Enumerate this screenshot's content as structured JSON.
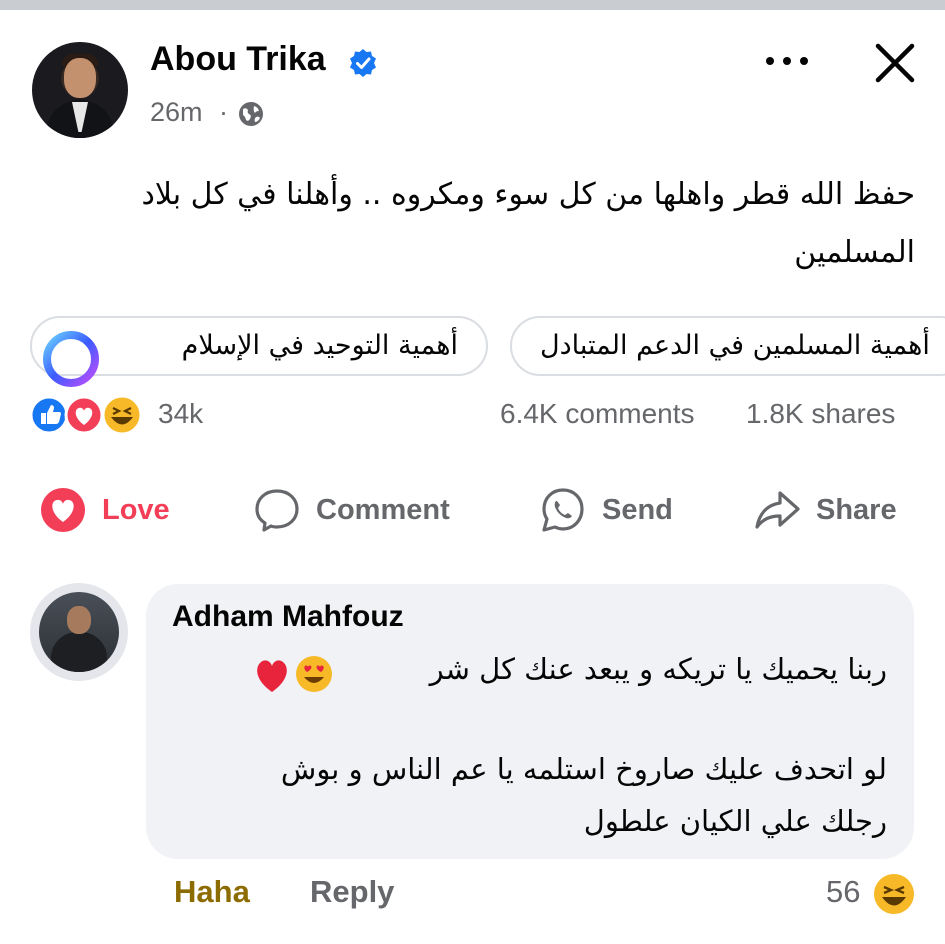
{
  "post": {
    "author": "Abou Trika",
    "time": "26m",
    "separator": "·",
    "text": "حفظ الله قطر واهلها من كل سوء ومكروه .. وأهلنا في كل بلاد المسلمين",
    "verified": true
  },
  "suggestions": [
    {
      "label": "أهمية التوحيد في الإسلام"
    },
    {
      "label": "أهمية المسلمين في الدعم المتبادل"
    }
  ],
  "stats": {
    "reactions": "34k",
    "comments": "6.4K comments",
    "shares": "1.8K shares",
    "reaction_types": [
      "like-icon",
      "love-icon",
      "haha-icon"
    ]
  },
  "actions": {
    "love": "Love",
    "comment": "Comment",
    "send": "Send",
    "share": "Share"
  },
  "comment": {
    "author": "Adham Mahfouz",
    "line1": "ربنا يحميك يا تريكه و يبعد عنك كل شر",
    "line2": "لو اتحدف عليك صاروخ استلمه يا عم الناس و بوش",
    "line3": "رجلك علي الكيان علطول",
    "haha_label": "Haha",
    "reply_label": "Reply",
    "reaction_count": "56"
  },
  "colors": {
    "love": "#f33e58",
    "like": "#1877f2",
    "haha": "#f7b928",
    "secondary_text": "#65676b",
    "bubble": "#f0f2f5"
  }
}
